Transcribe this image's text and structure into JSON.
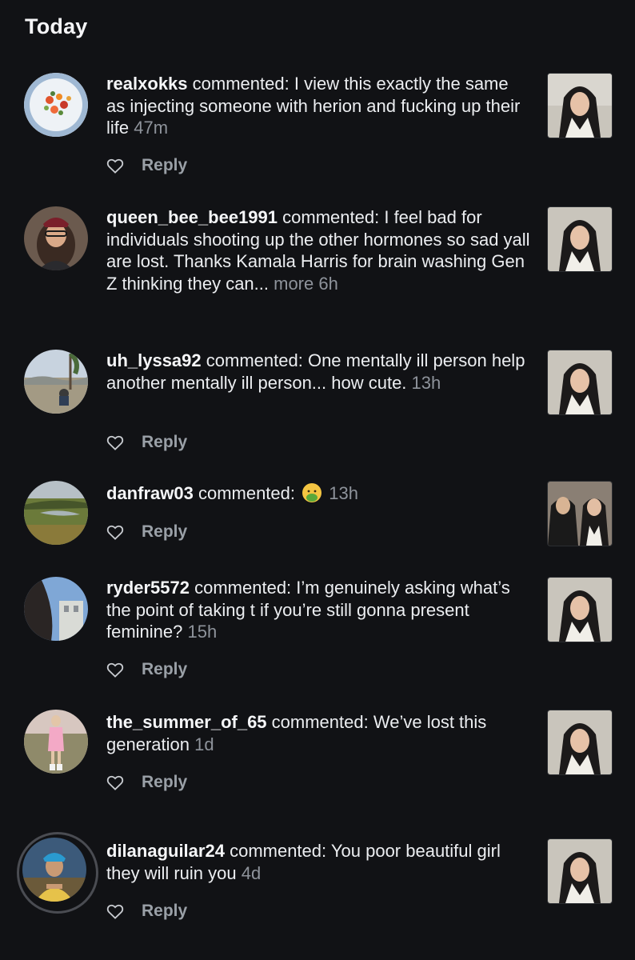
{
  "section_title": "Today",
  "verb": "commented:",
  "reply_label": "Reply",
  "notifications": [
    {
      "username": "realxokks",
      "comment": "I view this exactly the same as injecting someone with herion and fucking up their life",
      "time": "47m",
      "more": ""
    },
    {
      "username": "queen_bee_bee1991",
      "comment": "I feel bad for individuals shooting up the other hormones so sad yall are lost. Thanks Kamala Harris for brain washing Gen Z thinking they can...",
      "time": "6h",
      "more": "more"
    },
    {
      "username": "uh_lyssa92",
      "comment": "One mentally ill person help another mentally ill person... how cute.",
      "time": "13h",
      "more": ""
    },
    {
      "username": "danfraw03",
      "comment": "",
      "emoji": "nauseated-face",
      "time": "13h",
      "more": ""
    },
    {
      "username": "ryder5572",
      "comment": "I’m genuinely asking what’s the point of taking t if you’re still gonna present feminine?",
      "time": "15h",
      "more": ""
    },
    {
      "username": "the_summer_of_65",
      "comment": "We’ve lost this generation",
      "time": "1d",
      "more": ""
    },
    {
      "username": "dilanaguilar24",
      "comment": "You poor beautiful girl they will ruin you",
      "time": "4d",
      "more": ""
    }
  ],
  "colors": {
    "background": "#111215",
    "text": "#eceef1",
    "muted": "#8e939b"
  }
}
